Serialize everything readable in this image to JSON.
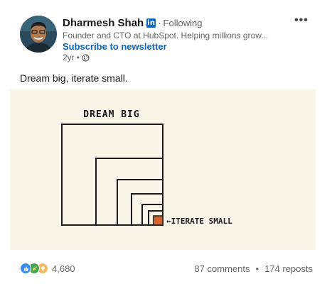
{
  "author": {
    "name": "Dharmesh Shah",
    "badge": "in",
    "separator": "·",
    "follow_status": "Following",
    "headline": "Founder and CTO at HubSpot. Helping millions grow...",
    "subscribe_label": "Subscribe to newsletter",
    "age": "2yr",
    "age_separator": "•",
    "visibility_icon": "globe-icon"
  },
  "menu_label": "•••",
  "post": {
    "text": "Dream big, iterate small.",
    "image": {
      "title": "DREAM BIG",
      "arrow_label": "←ITERATE SMALL",
      "background": "#f8f4e6",
      "accent": "#d9622b"
    }
  },
  "stats": {
    "reaction_icons": [
      "like-icon",
      "celebrate-icon",
      "insightful-icon"
    ],
    "reactions": "4,680",
    "comments": "87 comments",
    "separator": "•",
    "reposts": "174 reposts"
  },
  "colors": {
    "link": "#0a66c2",
    "muted": "#666666"
  }
}
